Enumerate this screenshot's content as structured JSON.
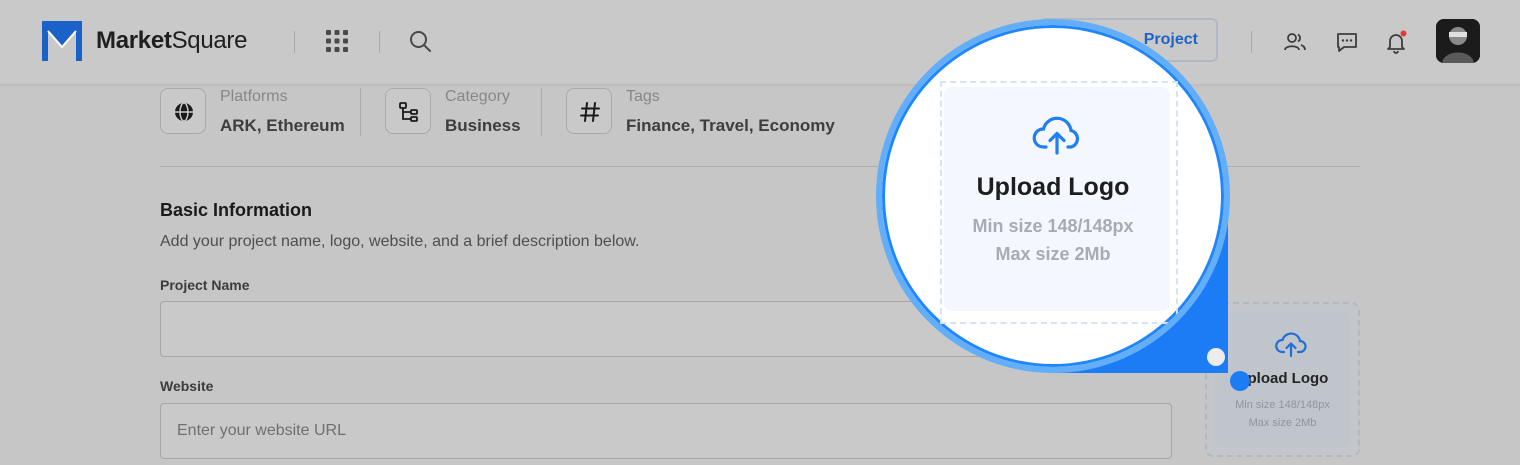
{
  "header": {
    "brand_bold": "Market",
    "brand_light": "Square",
    "add_project_label": "Project",
    "icons": [
      "apps-grid-icon",
      "search-icon",
      "users-icon",
      "chat-icon",
      "bell-icon"
    ],
    "notification_dot_color": "#e53935"
  },
  "info": [
    {
      "label": "Platforms",
      "value": "ARK, Ethereum",
      "icon": "globe-icon"
    },
    {
      "label": "Category",
      "value": "Business",
      "icon": "hierarchy-icon"
    },
    {
      "label": "Tags",
      "value": "Finance, Travel, Economy",
      "icon": "hashtag-icon"
    }
  ],
  "basic": {
    "title": "Basic Information",
    "description": "Add your project name, logo, website, and a brief description below."
  },
  "form": {
    "project_name_label": "Project Name",
    "project_name_value": "",
    "website_label": "Website",
    "website_placeholder": "Enter your website URL"
  },
  "upload": {
    "title": "Upload Logo",
    "min": "Min size 148/148px",
    "max": "Max size 2Mb"
  },
  "colors": {
    "accent": "#1f86ff",
    "brand_blue": "#1b62c8"
  }
}
